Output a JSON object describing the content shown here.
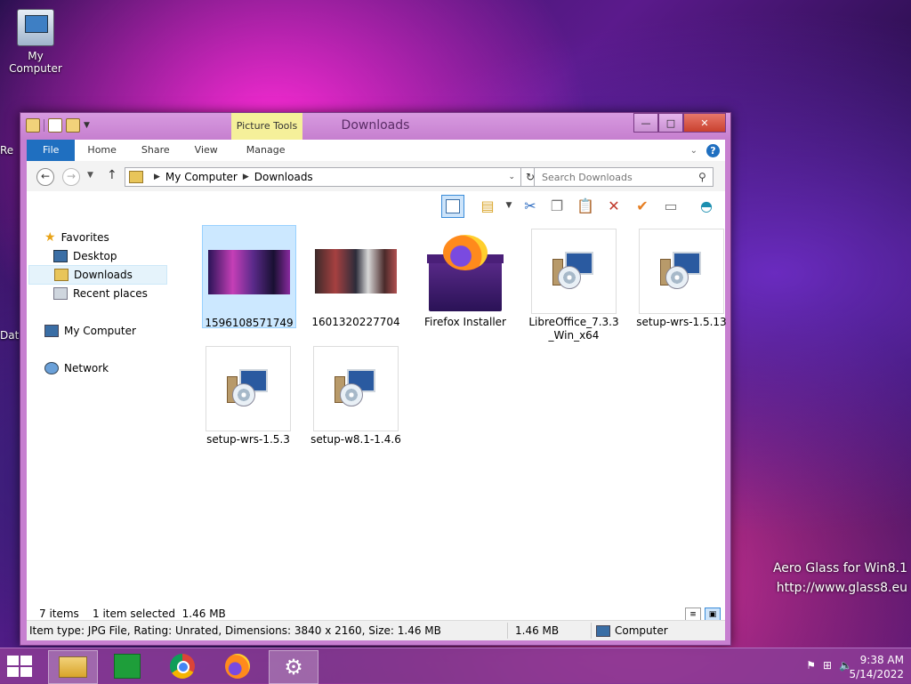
{
  "desktop": {
    "my_computer_label": "My Computer",
    "partial_labels": [
      "Re",
      "Dat"
    ],
    "watermark_line1": "Aero Glass for Win8.1",
    "watermark_line2": "http://www.glass8.eu"
  },
  "window": {
    "title": "Downloads",
    "picture_tools": "Picture Tools",
    "ribbon_tabs": [
      "File",
      "Home",
      "Share",
      "View",
      "Manage"
    ],
    "address": {
      "crumbs": [
        "My Computer",
        "Downloads"
      ]
    },
    "search_placeholder": "Search Downloads",
    "nav": {
      "favorites": "Favorites",
      "desktop": "Desktop",
      "downloads": "Downloads",
      "recent": "Recent places",
      "computer": "My Computer",
      "network": "Network"
    },
    "files": [
      {
        "name": "1596108571749",
        "type": "photo",
        "selected": true
      },
      {
        "name": "1601320227704",
        "type": "photo",
        "selected": false
      },
      {
        "name": "Firefox Installer",
        "type": "firefox",
        "selected": false
      },
      {
        "name": "LibreOffice_7.3.3_Win_x64",
        "type": "setup",
        "selected": false
      },
      {
        "name": "setup-wrs-1.5.13",
        "type": "setup",
        "selected": false
      },
      {
        "name": "setup-wrs-1.5.3",
        "type": "setup",
        "selected": false
      },
      {
        "name": "setup-w8.1-1.4.6",
        "type": "setup",
        "selected": false
      }
    ],
    "status": {
      "items": "7 items",
      "selected": "1 item selected  1.46 MB",
      "details": "Item type: JPG File, Rating: Unrated, Dimensions: 3840 x 2160, Size: 1.46 MB",
      "size": "1.46 MB",
      "location": "Computer"
    }
  },
  "taskbar": {
    "time": "9:38 AM",
    "date": "5/14/2022"
  },
  "colors": {
    "file_tab": "#1f6fc0",
    "window_frame": "#c77fd0",
    "selection": "#cce8ff"
  }
}
